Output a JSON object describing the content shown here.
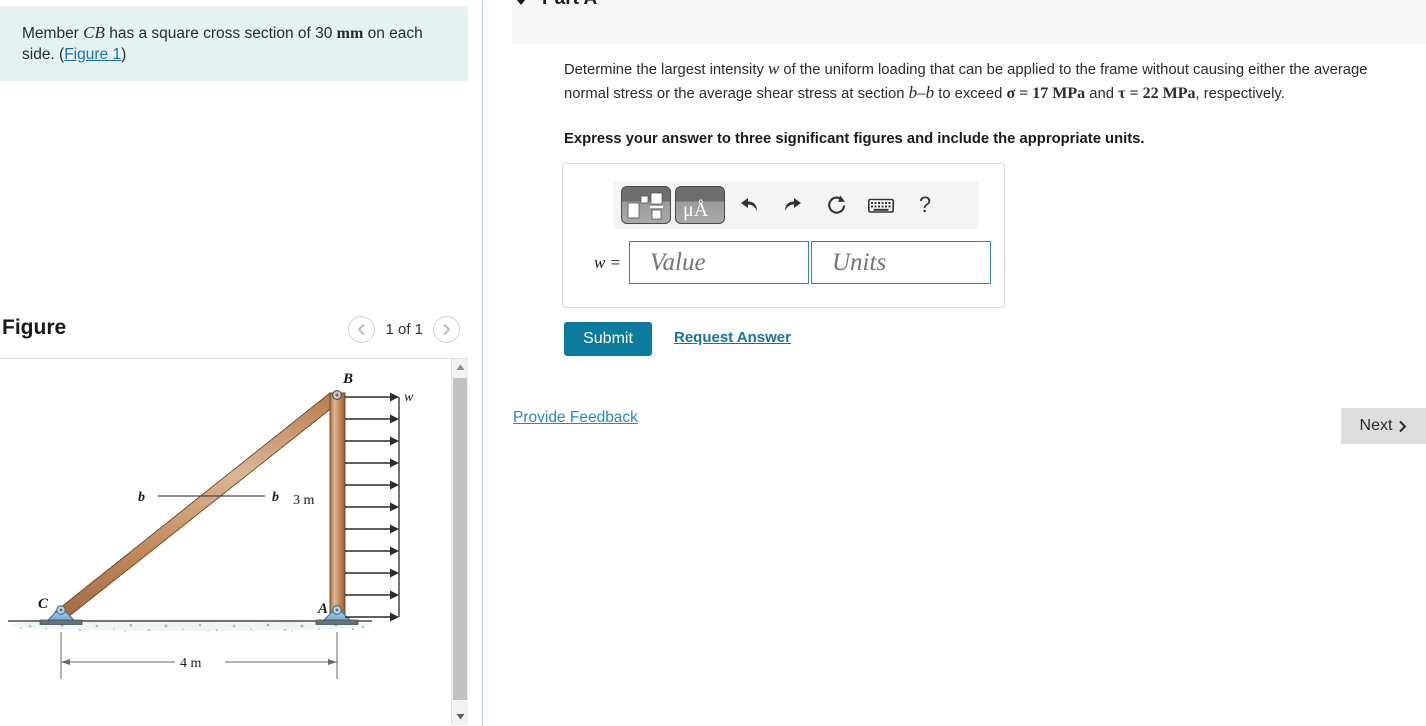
{
  "left_panel": {
    "problem_prefix": "Member ",
    "problem_member": "CB",
    "problem_mid": " has a square cross section of 30 ",
    "problem_unit": "mm",
    "problem_suffix": " on each side. (",
    "figure_link_label": "Figure 1",
    "problem_end": ")",
    "figure_section_title": "Figure",
    "figure_counter": "1 of 1",
    "prev_icon": "chevron-left-icon",
    "next_icon": "chevron-right-icon",
    "scrollbar_up_icon": "triangle-up-icon",
    "scrollbar_down_icon": "triangle-down-icon"
  },
  "figure": {
    "label_B": "B",
    "label_A": "A",
    "label_C": "C",
    "label_w": "w",
    "label_section_left": "b",
    "label_section_right": "b",
    "dim_vertical": "3 m",
    "dim_horizontal": "4 m",
    "arrow_count": 11,
    "beam_color": "#c08a5e",
    "support_color": "#8bbdd9"
  },
  "right_panel": {
    "part_title": "Part A",
    "collapse_icon": "triangle-down-icon",
    "question": {
      "seg1": "Determine the largest intensity ",
      "var_w": "w",
      "seg2": " of the uniform loading that can be applied to the frame without causing either the average normal stress or the average shear stress at section ",
      "section_label": "b–b",
      "seg3": " to exceed ",
      "sigma_expr": "σ = 17 MPa",
      "seg4": " and ",
      "tau_expr": "τ = 22 MPa",
      "seg5": ", respectively."
    },
    "instruction": "Express your answer to three significant figures and include the appropriate units.",
    "toolbar": {
      "template_icon": "math-template-icon",
      "units_icon": "units-mu-angstrom-icon",
      "units_label": "μÅ",
      "undo_icon": "undo-arrow-icon",
      "redo_icon": "redo-arrow-icon",
      "reset_icon": "reset-circular-arrow-icon",
      "keyboard_icon": "keyboard-icon",
      "help_icon": "question-mark-icon",
      "help_label": "?"
    },
    "answer": {
      "variable_label": "w =",
      "value_placeholder": "Value",
      "units_placeholder": "Units",
      "value_current": "",
      "units_current": ""
    },
    "submit_label": "Submit",
    "request_answer_label": "Request Answer",
    "provide_feedback_label": "Provide Feedback",
    "next_label": "Next",
    "next_icon": "chevron-right-icon"
  },
  "colors": {
    "info_box_bg": "#e4f3f2",
    "submit_teal": "#0b7b9e",
    "link_blue": "#2789bd",
    "input_border_teal": "#2b8a9e",
    "next_grey": "#dddddd"
  }
}
